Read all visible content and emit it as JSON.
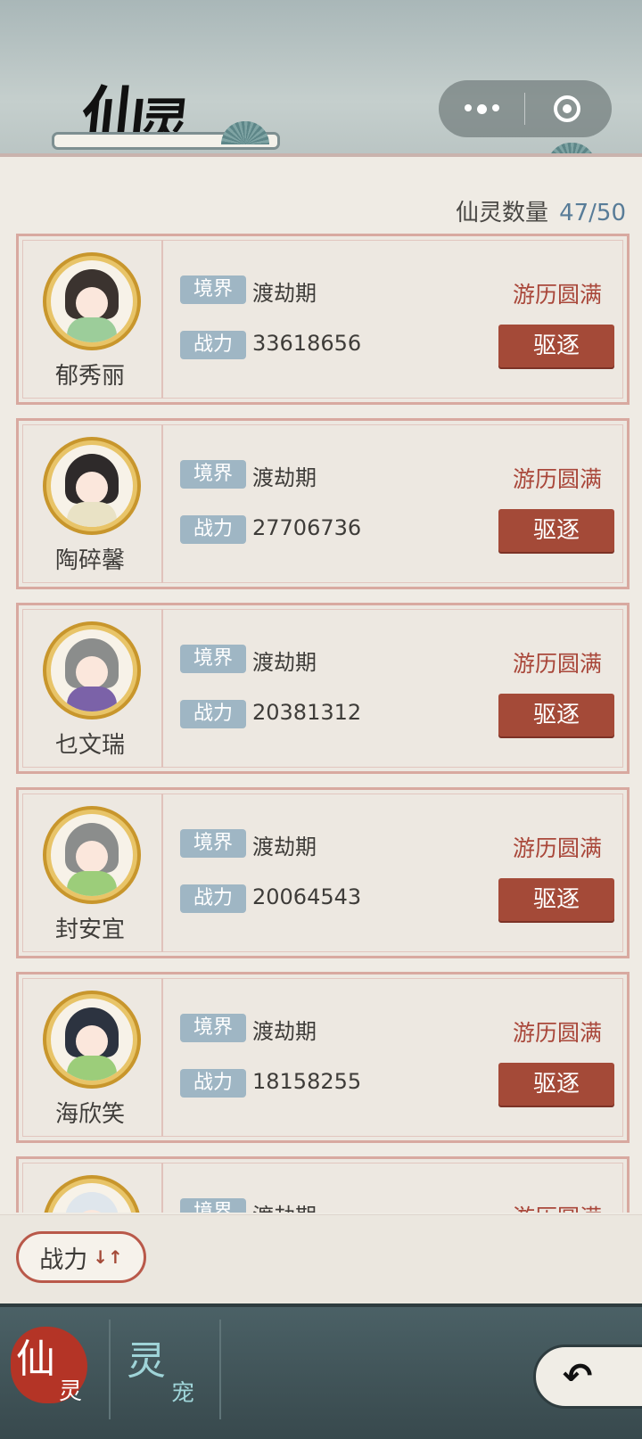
{
  "header": {
    "title_main": "仙",
    "title_second": "灵",
    "capsule": {
      "more_icon": "more-dots-icon",
      "close_icon": "target-circle-icon"
    }
  },
  "summary": {
    "label": "仙灵数量",
    "count": "47/50"
  },
  "labels": {
    "realm": "境界",
    "power": "战力",
    "expel": "驱逐"
  },
  "spirits": [
    {
      "name": "郁秀丽",
      "realm": "渡劫期",
      "power": "33618656",
      "status": "游历圆满",
      "hair": "#3b332f",
      "outfit": "#9ccd9a"
    },
    {
      "name": "陶碎馨",
      "realm": "渡劫期",
      "power": "27706736",
      "status": "游历圆满",
      "hair": "#2e2a2a",
      "outfit": "#e9e2c5"
    },
    {
      "name": "乜文瑞",
      "realm": "渡劫期",
      "power": "20381312",
      "status": "游历圆满",
      "hair": "#8b8d8c",
      "outfit": "#7b62a8"
    },
    {
      "name": "封安宜",
      "realm": "渡劫期",
      "power": "20064543",
      "status": "游历圆满",
      "hair": "#8b8d8c",
      "outfit": "#9ccd7a"
    },
    {
      "name": "海欣笑",
      "realm": "渡劫期",
      "power": "18158255",
      "status": "游历圆满",
      "hair": "#2c3340",
      "outfit": "#9ccd7a"
    },
    {
      "name": "",
      "realm": "渡劫期",
      "power": "",
      "status": "游历圆满",
      "hair": "#dfe6ec",
      "outfit": "#e9e2c5"
    }
  ],
  "sort": {
    "label": "战力",
    "icon": "sort-arrows-icon"
  },
  "nav": {
    "tab1_big": "仙",
    "tab1_small": "灵",
    "tab2_big": "灵",
    "tab2_small": "宠",
    "back_icon": "back-arrow-icon"
  },
  "colors": {
    "accent": "#a44a38",
    "count": "#587c98",
    "tag": "#9fb6c4"
  }
}
